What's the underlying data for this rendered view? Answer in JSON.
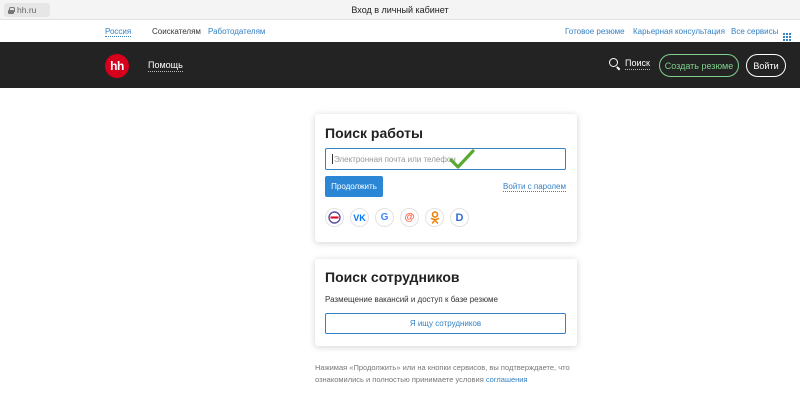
{
  "browser": {
    "address": "hh.ru",
    "title": "Вход в личный кабинет"
  },
  "topbar": {
    "region": "Россия",
    "seekers": "Соискателям",
    "employers": "Работодателям",
    "ready_resume": "Готовое резюме",
    "career": "Карьерная консультация",
    "all_services": "Все сервисы"
  },
  "header": {
    "logo": "hh",
    "help": "Помощь",
    "search": "Поиск",
    "create_resume": "Создать резюме",
    "login": "Войти"
  },
  "job_search": {
    "title": "Поиск работы",
    "input_placeholder": "Электронная почта или телефон",
    "continue_label": "Продолжить",
    "password_link": "Войти с паролем",
    "socials": [
      {
        "name": "Госуслуги",
        "icon": "gosuslugi-icon",
        "glyph": "Г",
        "color": "#5b4fa0"
      },
      {
        "name": "ВКонтакте",
        "icon": "vk-icon",
        "glyph": "VK",
        "color": "#0077ff"
      },
      {
        "name": "Google",
        "icon": "google-icon",
        "glyph": "G",
        "color": "#4285f4"
      },
      {
        "name": "Mail.ru",
        "icon": "mailru-icon",
        "glyph": "@",
        "color": "#ff4f35"
      },
      {
        "name": "Одноклассники",
        "icon": "ok-icon",
        "glyph": "ок",
        "color": "#ee8208"
      },
      {
        "name": "Яндекс",
        "icon": "d-icon",
        "glyph": "D",
        "color": "#2f6fd6"
      }
    ]
  },
  "employer_search": {
    "title": "Поиск сотрудников",
    "description": "Размещение вакансий и доступ к базе резюме",
    "button_label": "Я ищу сотрудников"
  },
  "footer": {
    "note": "Нажимая «Продолжить» или на кнопки сервисов, вы подтверждаете, что ознакомились и полностью принимаете условия",
    "agreement_link": "соглашения"
  },
  "colors": {
    "brand_red": "#d6001c",
    "link_blue": "#3481c4",
    "header_bg": "#232323",
    "accent_green": "#7fd08c",
    "check_green": "#5aa832"
  }
}
